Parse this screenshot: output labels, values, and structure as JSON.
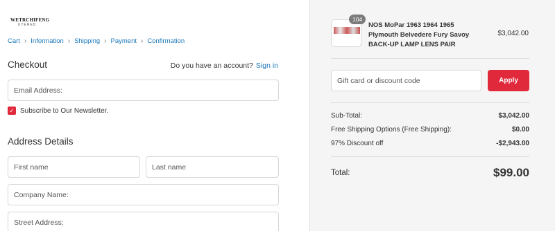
{
  "brand": {
    "line1": "WETRCHIFENG",
    "line2": "UTERED"
  },
  "breadcrumb": [
    "Cart",
    "Information",
    "Shipping",
    "Payment",
    "Confirmation"
  ],
  "checkout": {
    "title": "Checkout",
    "account_prompt": "Do you have an account?",
    "sign_in": "Sign in",
    "email_placeholder": "Email Address:",
    "newsletter_label": "Subscribe to Our Newsletter.",
    "newsletter_checked": true
  },
  "address": {
    "title": "Address Details",
    "first_name": "First name",
    "last_name": "Last name",
    "company": "Company Name:",
    "street": "Street Address:"
  },
  "cart": {
    "quantity_badge": "104",
    "product_name": "NOS MoPar 1963 1964 1965 Plymouth Belvedere Fury Savoy BACK-UP LAMP LENS PAIR",
    "product_price": "$3,042.00",
    "discount_placeholder": "Gift card or discount code",
    "apply_label": "Apply",
    "subtotal_label": "Sub-Total:",
    "subtotal_value": "$3,042.00",
    "shipping_label": "Free Shipping Options (Free Shipping):",
    "shipping_value": "$0.00",
    "discount_label": "97% Discount off",
    "discount_value": "-$2,943.00",
    "total_label": "Total:",
    "total_value": "$99.00"
  },
  "colors": {
    "accent": "#e0293b",
    "link": "#1976b8",
    "sidebar_bg": "#f5f5f5"
  },
  "icons": {
    "breadcrumb_separator": "chevron-right-icon",
    "checkbox": "check-icon"
  }
}
